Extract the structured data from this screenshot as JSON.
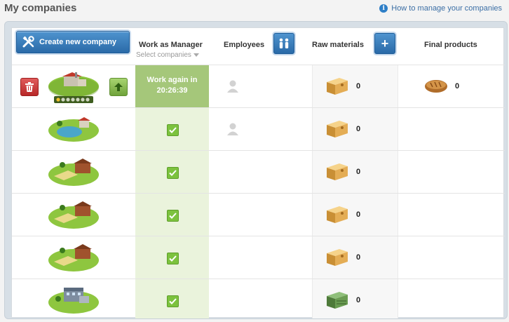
{
  "page": {
    "title": "My companies",
    "help_link": "How to manage your companies"
  },
  "header": {
    "create_button": "Create new company",
    "work_as_manager": "Work as Manager",
    "select_companies": "Select companies",
    "employees": "Employees",
    "raw_materials": "Raw materials",
    "final_products": "Final products"
  },
  "rows": [
    {
      "type": "factory-food",
      "stars": 7,
      "manager_status": "Work again in",
      "manager_timer": "20:26:39",
      "has_employee": true,
      "raw_icon": "wooden-crate-icon",
      "raw_count": "0",
      "final_icon": "bread-icon",
      "final_count": "0"
    },
    {
      "type": "fishing-farm",
      "manager_status": "checked",
      "has_employee": true,
      "raw_icon": "wooden-crate-icon",
      "raw_count": "0"
    },
    {
      "type": "grain-farm",
      "manager_status": "checked",
      "has_employee": false,
      "raw_icon": "wooden-crate-icon",
      "raw_count": "0"
    },
    {
      "type": "grain-farm",
      "manager_status": "checked",
      "has_employee": false,
      "raw_icon": "wooden-crate-icon",
      "raw_count": "0"
    },
    {
      "type": "grain-farm",
      "manager_status": "checked",
      "has_employee": false,
      "raw_icon": "wooden-crate-icon",
      "raw_count": "0"
    },
    {
      "type": "factory-industrial",
      "manager_status": "checked",
      "has_employee": false,
      "raw_icon": "green-crate-icon",
      "raw_count": "0"
    }
  ],
  "colors": {
    "button_blue": "#2a6aa8",
    "manager_active": "#a5c77a",
    "manager_bg": "#eaf3dc",
    "check_green": "#7cc23e"
  }
}
